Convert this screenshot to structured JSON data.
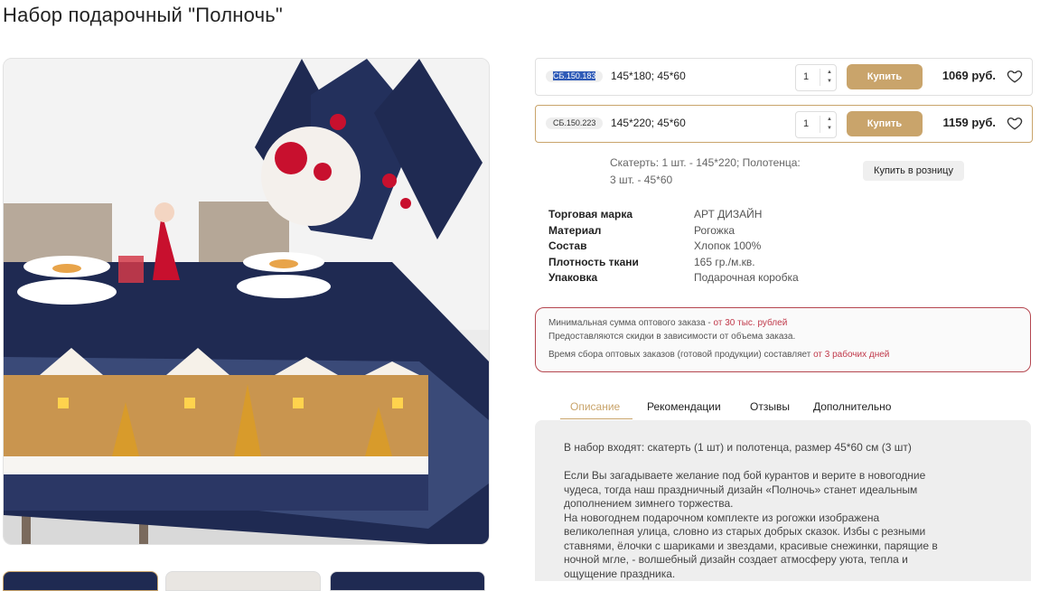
{
  "page": {
    "title": "Набор подарочный \"Полночь\""
  },
  "variants": [
    {
      "sku": "СБ.150.183",
      "size": "145*180; 45*60",
      "qty": "1",
      "buy_label": "Купить",
      "price": "1069 руб."
    },
    {
      "sku": "СБ.150.223",
      "size": "145*220; 45*60",
      "qty": "1",
      "buy_label": "Купить",
      "price": "1159 руб."
    }
  ],
  "set_note": {
    "line1": "Скатерть: 1 шт. - 145*220; Полотенца:",
    "line2": "3 шт. - 45*60"
  },
  "retail_button": "Купить в розницу",
  "specs": [
    {
      "key": "Торговая марка",
      "value": "АРТ ДИЗАЙН"
    },
    {
      "key": "Материал",
      "value": "Рогожка"
    },
    {
      "key": "Состав",
      "value": "Хлопок 100%"
    },
    {
      "key": "Плотность ткани",
      "value": "165 гр./м.кв."
    },
    {
      "key": "Упаковка",
      "value": "Подарочная коробка"
    }
  ],
  "wholesale": {
    "line1_text": "Минимальная сумма оптового заказа - ",
    "line1_highlight": "от 30 тыс. рублей",
    "line2_text": "Предоставляются скидки в зависимости от объема заказа.",
    "line3_text": "Время сбора оптовых заказов (готовой продукции) составляет ",
    "line3_highlight": "от 3 рабочих дней"
  },
  "tabs": [
    "Описание",
    "Рекомендации",
    "Отзывы",
    "Дополнительно"
  ],
  "description": {
    "p1": "В набор входят: скатерть (1 шт)  и полотенца, размер 45*60 см (3 шт)",
    "p2_lines": [
      "Если Вы загадываете желание под бой курантов и верите в новогодние",
      "чудеса, тогда наш праздничный дизайн «Полночь» станет идеальным",
      "дополнением зимнего торжества.",
      "На новогоднем подарочном комплекте из рогожки изображена",
      "великолепная улица, словно из старых добрых сказок. Избы с резными",
      "ставнями, ёлочки с шариками и звездами, красивые снежинки, парящие в",
      "ночной мгле, - волшебный дизайн создает атмосферу уюта, тепла и",
      "ощущение праздника."
    ]
  },
  "colors": {
    "accent": "#c9a46b",
    "wholesale_border": "#b5464f",
    "highlight": "#c0394a",
    "navy": "#1f2a52"
  },
  "icons": {
    "favorite": "heart-icon",
    "qty_up": "chevron-up-icon",
    "qty_down": "chevron-down-icon"
  }
}
